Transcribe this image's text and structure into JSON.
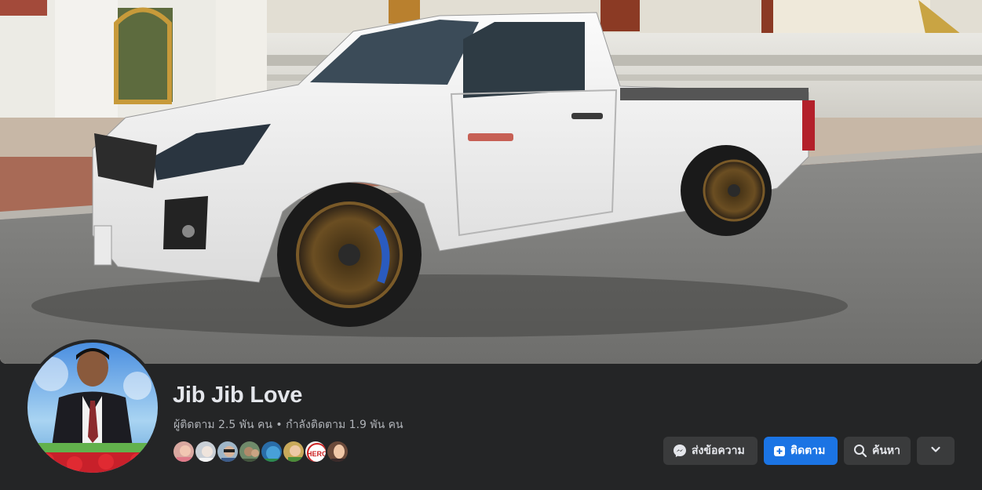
{
  "profile": {
    "name": "Jib Jib Love",
    "followers_text": "ผู้ติดตาม 2.5 พัน คน",
    "separator": "•",
    "following_text": "กำลังติดตาม 1.9 พัน คน"
  },
  "actions": {
    "message_label": "ส่งข้อความ",
    "follow_label": "ติดตาม",
    "search_label": "ค้นหา"
  },
  "follower_avatars": [
    "follower-1",
    "follower-2",
    "follower-3",
    "follower-4",
    "follower-5",
    "follower-6",
    "follower-7",
    "follower-8"
  ],
  "cover_badge": "HERO",
  "colors": {
    "background": "#242526",
    "primary_button": "#1b74e4",
    "secondary_button": "#3a3b3c",
    "text_primary": "#e4e6eb",
    "text_secondary": "#b0b3b8"
  },
  "icons": {
    "message": "messenger-icon",
    "follow": "follow-plus-icon",
    "search": "search-icon",
    "more": "chevron-down-icon"
  }
}
